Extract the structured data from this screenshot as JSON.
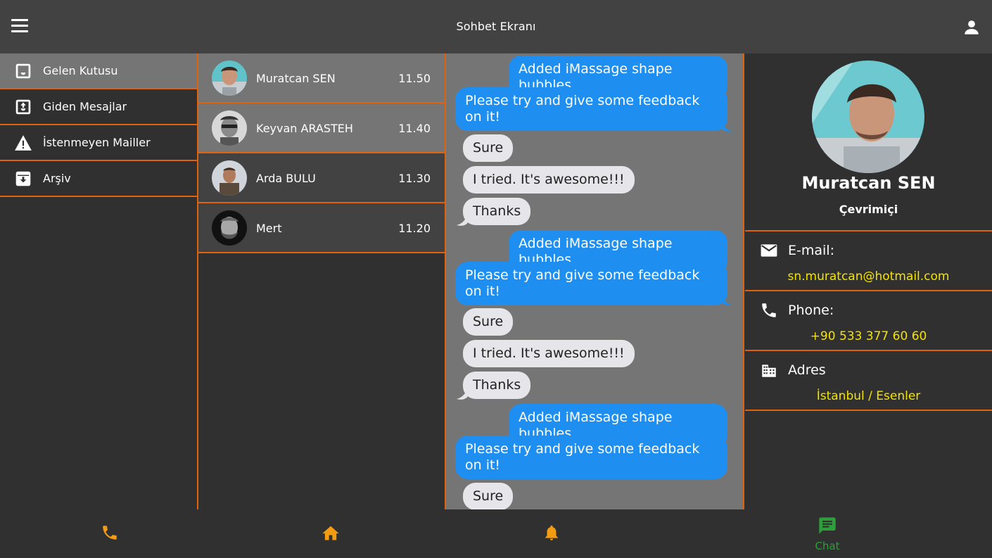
{
  "appbar": {
    "title": "Sohbet Ekranı",
    "menu_icon": "menu-icon",
    "account_icon": "account-icon"
  },
  "sidebar": {
    "items": [
      {
        "label": "Gelen Kutusu",
        "icon": "inbox-icon",
        "active": true
      },
      {
        "label": "Giden Mesajlar",
        "icon": "outbox-icon",
        "active": false
      },
      {
        "label": "İstenmeyen Mailler",
        "icon": "warning-icon",
        "active": false
      },
      {
        "label": "Arşiv",
        "icon": "archive-icon",
        "active": false
      }
    ]
  },
  "contacts": [
    {
      "name": "Muratcan SEN",
      "time": "11.50"
    },
    {
      "name": "Keyvan ARASTEH",
      "time": "11.40"
    },
    {
      "name": "Arda BULU",
      "time": "11.30"
    },
    {
      "name": "Mert",
      "time": "11.20"
    }
  ],
  "messages": [
    {
      "dir": "out",
      "text": "Added iMassage shape bubbles"
    },
    {
      "dir": "out",
      "text": "Please try and give some feedback on it!"
    },
    {
      "dir": "in",
      "text": "Sure"
    },
    {
      "dir": "in",
      "text": "I tried. It's awesome!!!"
    },
    {
      "dir": "in",
      "text": "Thanks"
    },
    {
      "dir": "out",
      "text": "Added iMassage shape bubbles"
    },
    {
      "dir": "out",
      "text": "Please try and give some feedback on it!"
    },
    {
      "dir": "in",
      "text": "Sure"
    },
    {
      "dir": "in",
      "text": "I tried. It's awesome!!!"
    },
    {
      "dir": "in",
      "text": "Thanks"
    },
    {
      "dir": "out",
      "text": "Added iMassage shape bubbles"
    },
    {
      "dir": "out",
      "text": "Please try and give some feedback on it!"
    },
    {
      "dir": "in",
      "text": "Sure"
    }
  ],
  "profile": {
    "name": "Muratcan SEN",
    "status": "Çevrimiçi",
    "email_label": "E-mail:",
    "email": "sn.muratcan@hotmail.com",
    "phone_label": "Phone:",
    "phone": "+90 533 377 60 60",
    "address_label": "Adres",
    "address": "İstanbul / Esenler"
  },
  "bottomnav": {
    "items": [
      {
        "icon": "phone-icon",
        "label": ""
      },
      {
        "icon": "home-icon",
        "label": ""
      },
      {
        "icon": "bell-icon",
        "label": ""
      },
      {
        "icon": "chat-icon",
        "label": "Chat"
      }
    ]
  },
  "colors": {
    "accent": "#e0620f",
    "nav_icon": "#f39c12",
    "nav_active": "#2e9e3a",
    "bubble_out": "#1e8ff0",
    "bubble_in": "#e6e6ea",
    "highlight_text": "#f5e300"
  }
}
